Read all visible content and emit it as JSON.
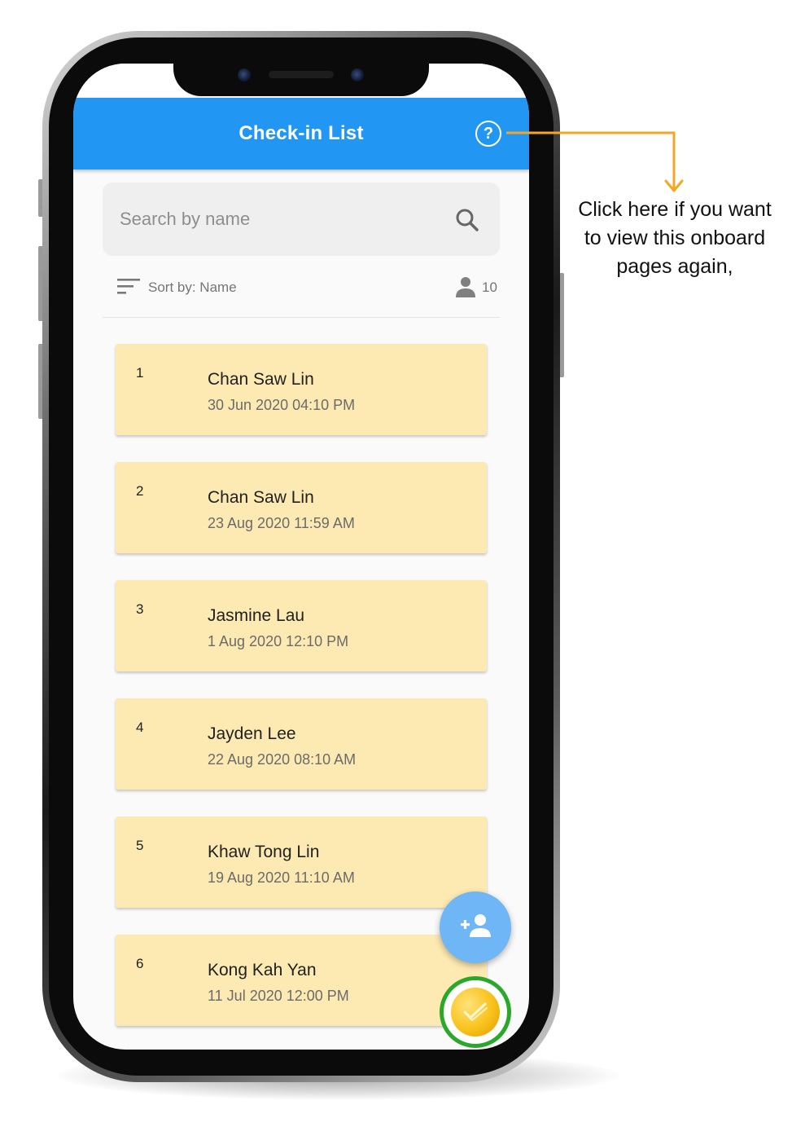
{
  "appbar": {
    "title": "Check-in List",
    "help_icon": "help-circle-icon"
  },
  "search": {
    "placeholder": "Search by name",
    "icon": "search-icon"
  },
  "sort": {
    "label": "Sort by: Name",
    "icon": "sort-lines-icon"
  },
  "count": {
    "value": "10",
    "icon": "person-icon"
  },
  "checkins": [
    {
      "number": "1",
      "name": "Chan Saw Lin",
      "datetime": "30 Jun 2020 04:10 PM"
    },
    {
      "number": "2",
      "name": "Chan Saw Lin",
      "datetime": "23 Aug 2020 11:59 AM"
    },
    {
      "number": "3",
      "name": "Jasmine Lau",
      "datetime": "1 Aug 2020 12:10 PM"
    },
    {
      "number": "4",
      "name": "Jayden Lee",
      "datetime": "22 Aug 2020 08:10 AM"
    },
    {
      "number": "5",
      "name": "Khaw Tong Lin",
      "datetime": "19 Aug 2020 11:10 AM"
    },
    {
      "number": "6",
      "name": "Kong Kah Yan",
      "datetime": "11 Jul 2020 12:00 PM"
    }
  ],
  "fabs": {
    "add_icon": "add-person-icon",
    "coin_icon": "coin-icon"
  },
  "callout": {
    "line1": "Click here if you want",
    "line2": "to view this onboard",
    "line3": "pages again,"
  },
  "colors": {
    "appbar": "#2196f3",
    "card": "#fde9b2",
    "callout_arrow": "#f5a623",
    "coin_ring": "#2aa82a"
  }
}
